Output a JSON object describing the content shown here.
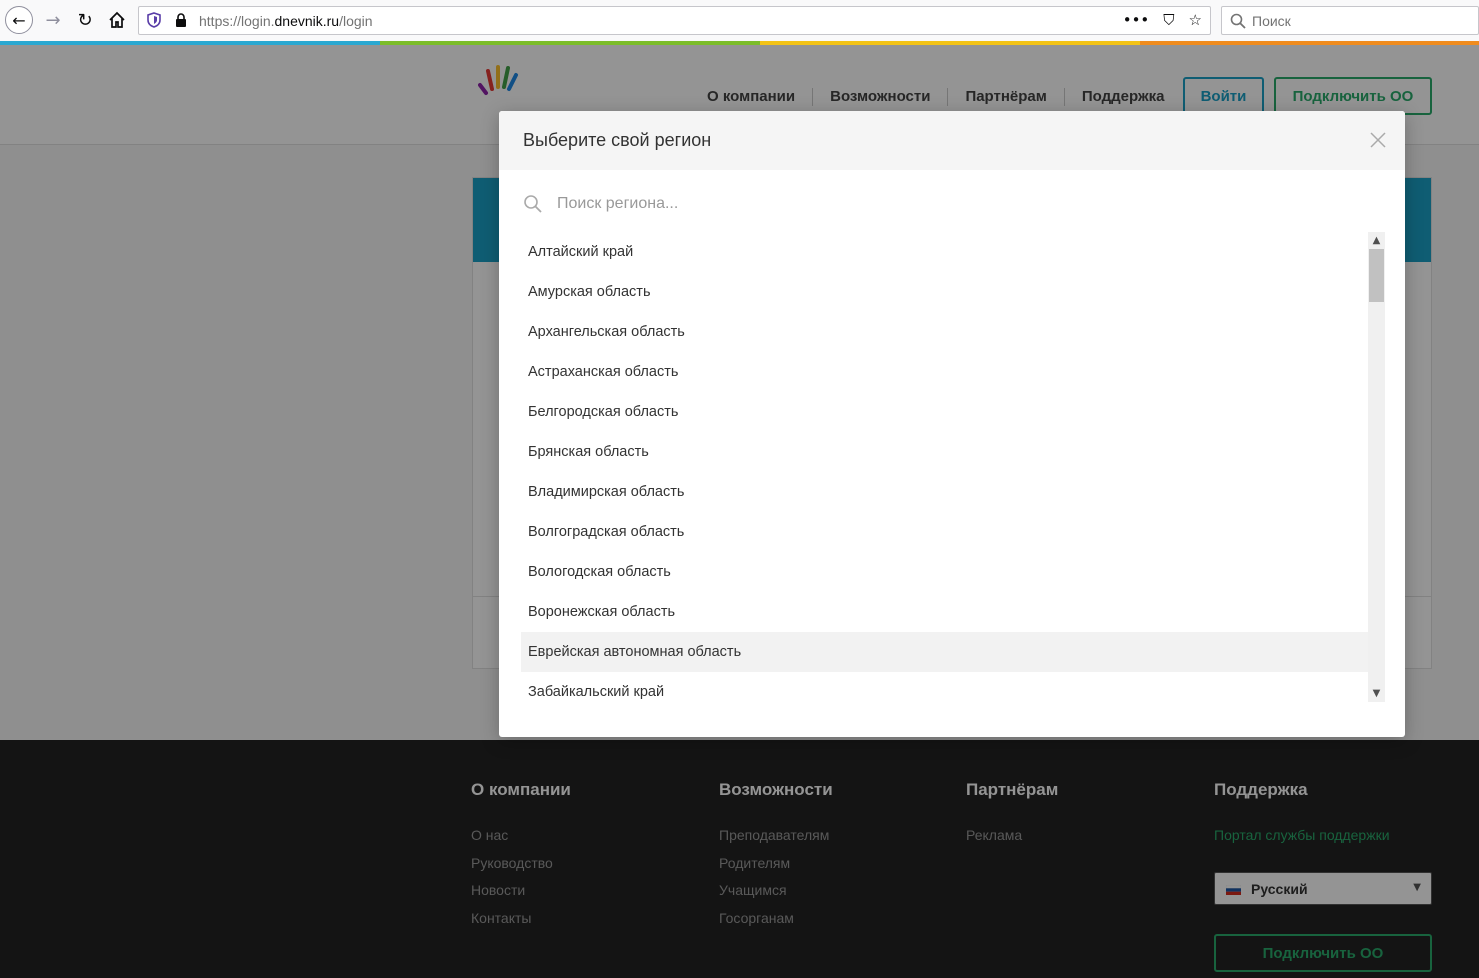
{
  "browser": {
    "url_prefix": "https://login.",
    "url_domain": "dnevnik.ru",
    "url_path": "/login",
    "more_glyph": "•••",
    "pocket_glyph": "⛉",
    "star_glyph": "☆",
    "search_placeholder": "Поиск"
  },
  "site": {
    "nav": [
      "О компании",
      "Возможности",
      "Партнёрам",
      "Поддержка"
    ],
    "login_button": "Войти",
    "connect_button": "Подключить ОО",
    "accent_blue": "#1aa0c6",
    "accent_green": "#2aab6b"
  },
  "modal": {
    "title": "Выберите свой регион",
    "search_placeholder": "Поиск региона...",
    "regions": [
      "Алтайский край",
      "Амурская область",
      "Архангельская область",
      "Астраханская область",
      "Белгородская область",
      "Брянская область",
      "Владимирская область",
      "Волгоградская область",
      "Вологодская область",
      "Воронежская область",
      "Еврейская автономная область",
      "Забайкальский край"
    ],
    "hovered_region": "Еврейская автономная область"
  },
  "footer": {
    "columns": [
      {
        "title": "О компании",
        "links": [
          "О нас",
          "Руководство",
          "Новости",
          "Контакты"
        ]
      },
      {
        "title": "Возможности",
        "links": [
          "Преподавателям",
          "Родителям",
          "Учащимся",
          "Госорганам"
        ]
      },
      {
        "title": "Партнёрам",
        "links": [
          "Реклама"
        ]
      },
      {
        "title": "Поддержка",
        "links": [
          "Портал службы поддержки"
        ]
      }
    ],
    "language": "Русский",
    "connect_button": "Подключить ОО"
  }
}
